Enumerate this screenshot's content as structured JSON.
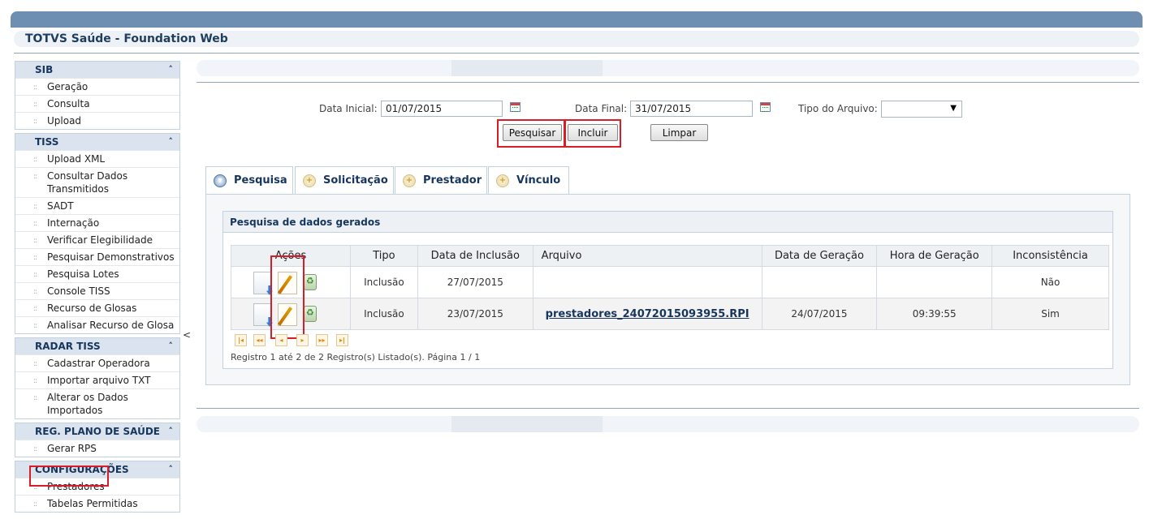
{
  "app": {
    "title": "TOTVS Saúde - Foundation Web"
  },
  "sidebar": {
    "groups": [
      {
        "title": "SIB",
        "items": [
          "Geração",
          "Consulta",
          "Upload"
        ]
      },
      {
        "title": "TISS",
        "items": [
          "Upload XML",
          "Consultar Dados Transmitidos",
          "SADT",
          "Internação",
          "Verificar Elegibilidade",
          "Pesquisar Demonstrativos",
          "Pesquisa Lotes",
          "Console TISS",
          "Recurso de Glosas",
          "Analisar Recurso de Glosa"
        ]
      },
      {
        "title": "RADAR TISS",
        "items": [
          "Cadastrar Operadora",
          "Importar arquivo TXT",
          "Alterar os Dados Importados"
        ]
      },
      {
        "title": "REG. PLANO DE SAÚDE",
        "items": [
          "Gerar RPS"
        ]
      },
      {
        "title": "CONFIGURAÇÕES",
        "items": [
          "Prestadores",
          "Tabelas Permitidas"
        ]
      }
    ],
    "collapse_glyph": "<"
  },
  "form": {
    "data_inicial_label": "Data Inicial:",
    "data_inicial_value": "01/07/2015",
    "data_final_label": "Data Final:",
    "data_final_value": "31/07/2015",
    "tipo_arquivo_label": "Tipo do Arquivo:",
    "tipo_arquivo_value": ""
  },
  "buttons": {
    "pesquisar": "Pesquisar",
    "incluir": "Incluir",
    "limpar": "Limpar"
  },
  "tabs": [
    {
      "label": "Pesquisa",
      "active": true
    },
    {
      "label": "Solicitação",
      "active": false
    },
    {
      "label": "Prestador",
      "active": false
    },
    {
      "label": "Vínculo",
      "active": false
    }
  ],
  "results": {
    "title": "Pesquisa de dados gerados",
    "columns": [
      "Ações",
      "Tipo",
      "Data de Inclusão",
      "Arquivo",
      "Data de Geração",
      "Hora de Geração",
      "Inconsistência"
    ],
    "rows": [
      {
        "tipo": "Inclusão",
        "data_inclusao": "27/07/2015",
        "arquivo": "",
        "data_geracao": "",
        "hora_geracao": "",
        "inconsistencia": "Não"
      },
      {
        "tipo": "Inclusão",
        "data_inclusao": "23/07/2015",
        "arquivo": "prestadores_24072015093955.RPI",
        "data_geracao": "24/07/2015",
        "hora_geracao": "09:39:55",
        "inconsistencia": "Sim"
      }
    ],
    "pager_text": "Registro 1 até 2 de 2 Registro(s) Listado(s). Página 1 / 1"
  },
  "colors": {
    "header_bar": "#6e8fb1",
    "title_text": "#17365d",
    "highlight": "#d71e28"
  },
  "icons": {
    "row_actions": [
      "download-document-icon",
      "edit-icon",
      "recycle-delete-icon"
    ],
    "pager": [
      "first-page-icon",
      "prev-block-icon",
      "prev-page-icon",
      "next-page-icon",
      "next-block-icon",
      "last-page-icon"
    ]
  }
}
